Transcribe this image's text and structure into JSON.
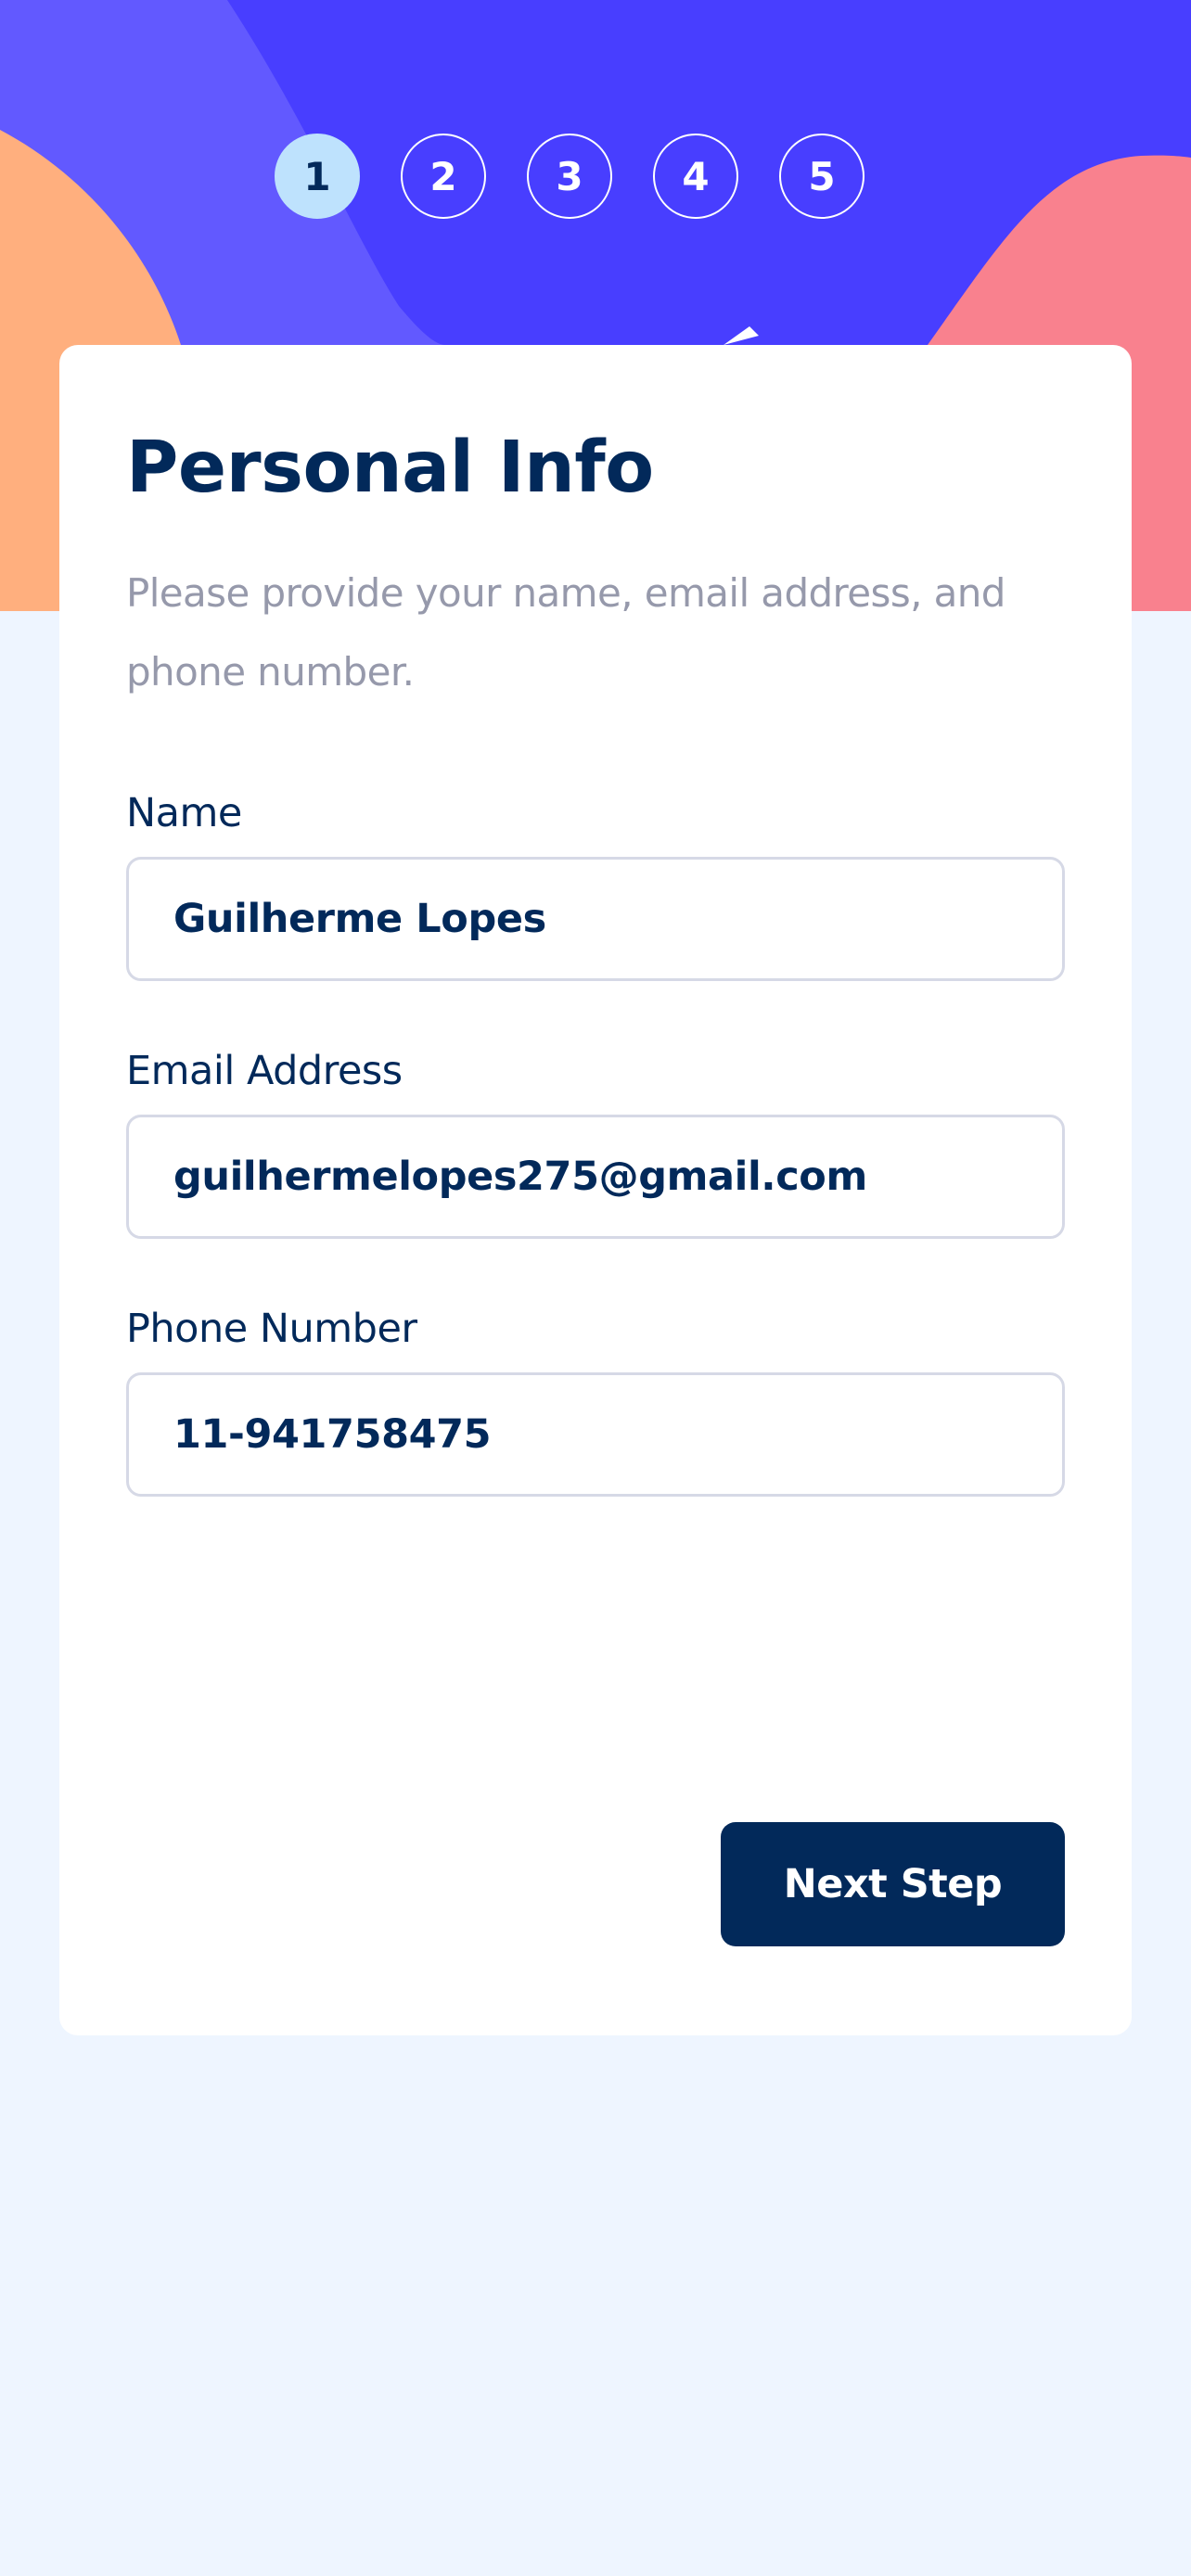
{
  "steps": [
    "1",
    "2",
    "3",
    "4",
    "5"
  ],
  "active_step": "1",
  "form": {
    "title": "Personal Info",
    "subtitle": "Please provide your name, email address, and phone number.",
    "fields": {
      "name": {
        "label": "Name",
        "value": "Guilherme Lopes"
      },
      "email": {
        "label": "Email Address",
        "value": "guilhermelopes275@gmail.com"
      },
      "phone": {
        "label": "Phone Number",
        "value": "11-941758475"
      }
    }
  },
  "actions": {
    "next_label": "Next Step"
  },
  "colors": {
    "header_purple": "#483EFF",
    "header_light_purple": "#6259FF",
    "header_orange": "#FFAF7E",
    "header_pink": "#F9818E",
    "marine_blue": "#02295A",
    "active_step_bg": "#BEE2FD",
    "page_bg": "#EEF5FF",
    "muted_text": "#9699AB",
    "border": "#D6D9E6"
  }
}
